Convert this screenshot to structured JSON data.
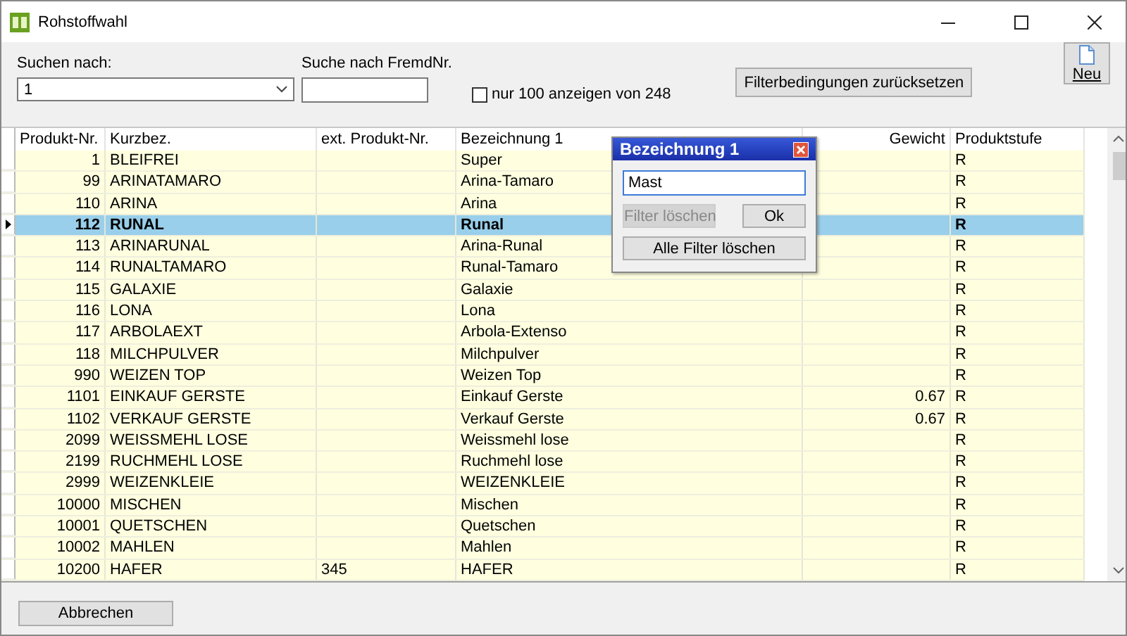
{
  "window": {
    "title": "Rohstoffwahl"
  },
  "search": {
    "label": "Suchen nach:",
    "value": "1"
  },
  "foreign_search": {
    "label": "Suche nach FremdNr."
  },
  "limit": {
    "label": "nur 100 anzeigen von 248",
    "checked": false
  },
  "reset_button": "Filterbedingungen zurücksetzen",
  "new_button": "Neu",
  "table": {
    "columns": [
      "Produkt-Nr.",
      "Kurzbez.",
      "ext. Produkt-Nr.",
      "Bezeichnung 1",
      "Gewicht",
      "Produktstufe"
    ],
    "rows": [
      {
        "cells": [
          "1",
          "BLEIFREI",
          "",
          "Super",
          "",
          "R"
        ],
        "selected": false
      },
      {
        "cells": [
          "99",
          "ARINATAMARO",
          "",
          "Arina-Tamaro",
          "",
          "R"
        ],
        "selected": false
      },
      {
        "cells": [
          "110",
          "ARINA",
          "",
          "Arina",
          "",
          "R"
        ],
        "selected": false
      },
      {
        "cells": [
          "112",
          "RUNAL",
          "",
          "Runal",
          "",
          "R"
        ],
        "selected": true
      },
      {
        "cells": [
          "113",
          "ARINARUNAL",
          "",
          "Arina-Runal",
          "",
          "R"
        ],
        "selected": false
      },
      {
        "cells": [
          "114",
          "RUNALTAMARO",
          "",
          "Runal-Tamaro",
          "",
          "R"
        ],
        "selected": false
      },
      {
        "cells": [
          "115",
          "GALAXIE",
          "",
          "Galaxie",
          "",
          "R"
        ],
        "selected": false
      },
      {
        "cells": [
          "116",
          "LONA",
          "",
          "Lona",
          "",
          "R"
        ],
        "selected": false
      },
      {
        "cells": [
          "117",
          "ARBOLAEXT",
          "",
          "Arbola-Extenso",
          "",
          "R"
        ],
        "selected": false
      },
      {
        "cells": [
          "118",
          "MILCHPULVER",
          "",
          "Milchpulver",
          "",
          "R"
        ],
        "selected": false
      },
      {
        "cells": [
          "990",
          "WEIZEN TOP",
          "",
          "Weizen Top",
          "",
          "R"
        ],
        "selected": false
      },
      {
        "cells": [
          "1101",
          "EINKAUF GERSTE",
          "",
          "Einkauf Gerste",
          "0.67",
          "R"
        ],
        "selected": false
      },
      {
        "cells": [
          "1102",
          "VERKAUF GERSTE",
          "",
          "Verkauf Gerste",
          "0.67",
          "R"
        ],
        "selected": false
      },
      {
        "cells": [
          "2099",
          "WEISSMEHL LOSE",
          "",
          "Weissmehl lose",
          "",
          "R"
        ],
        "selected": false
      },
      {
        "cells": [
          "2199",
          "RUCHMEHL LOSE",
          "",
          "Ruchmehl lose",
          "",
          "R"
        ],
        "selected": false
      },
      {
        "cells": [
          "2999",
          "WEIZENKLEIE",
          "",
          "WEIZENKLEIE",
          "",
          "R"
        ],
        "selected": false
      },
      {
        "cells": [
          "10000",
          "MISCHEN",
          "",
          "Mischen",
          "",
          "R"
        ],
        "selected": false
      },
      {
        "cells": [
          "10001",
          "QUETSCHEN",
          "",
          "Quetschen",
          "",
          "R"
        ],
        "selected": false
      },
      {
        "cells": [
          "10002",
          "MAHLEN",
          "",
          "Mahlen",
          "",
          "R"
        ],
        "selected": false
      },
      {
        "cells": [
          "10200",
          "HAFER",
          "345",
          "HAFER",
          "",
          "R"
        ],
        "selected": false
      }
    ]
  },
  "filter_popup": {
    "title": "Bezeichnung 1",
    "value": "Mast",
    "clear_button": {
      "label": "Filter löschen",
      "disabled": true
    },
    "ok_button": "Ok",
    "clear_all_button": "Alle Filter löschen"
  },
  "cancel_button": "Abbrechen"
}
